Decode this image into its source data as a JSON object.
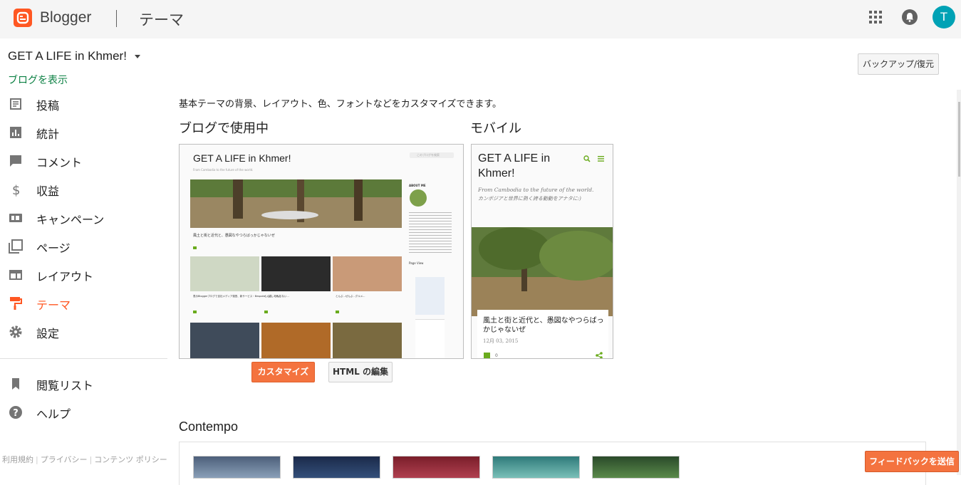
{
  "header": {
    "brand": "Blogger",
    "section_title": "テーマ",
    "avatar_initial": "T"
  },
  "sidebar": {
    "blog_name": "GET A LIFE in Khmer!",
    "view_blog": "ブログを表示",
    "items": [
      {
        "label": "投稿",
        "icon": "posts-icon"
      },
      {
        "label": "統計",
        "icon": "stats-icon"
      },
      {
        "label": "コメント",
        "icon": "comment-icon"
      },
      {
        "label": "収益",
        "icon": "dollar-icon"
      },
      {
        "label": "キャンペーン",
        "icon": "ad-icon"
      },
      {
        "label": "ページ",
        "icon": "pages-icon"
      },
      {
        "label": "レイアウト",
        "icon": "layout-icon"
      },
      {
        "label": "テーマ",
        "icon": "paint-roller-icon",
        "active": true
      },
      {
        "label": "設定",
        "icon": "gear-icon"
      }
    ],
    "secondary_items": [
      {
        "label": "閲覧リスト",
        "icon": "bookmark-icon"
      },
      {
        "label": "ヘルプ",
        "icon": "help-icon"
      }
    ],
    "footer_links": [
      "利用規約",
      "プライバシー",
      "コンテンツ ポリシー"
    ]
  },
  "main": {
    "backup_button": "バックアップ/復元",
    "description": "基本テーマの背景、レイアウト、色、フォントなどをカスタマイズできます。",
    "live_heading": "ブログで使用中",
    "mobile_heading": "モバイル",
    "customize_button": "カスタマイズ",
    "edit_html_button": "HTML の編集",
    "gallery_heading": "Contempo",
    "feedback_button": "フィードバックを送信"
  },
  "desktop_preview": {
    "blog_title": "GET A LIFE in Khmer!",
    "tagline": "From Cambodia to the future of the world.",
    "search_placeholder": "このブログを検索",
    "post_title": "風土と街と近代と、愚図なやつらばっかじゃないぜ",
    "about_heading": "ABOUT ME",
    "page_view_label": "Page View",
    "grid_captions": [
      "表示Bloggerブログで自社メディア運営、新サービス・Bespoke... 試してみた",
      "とんぷ...ぜんぶない...",
      "とんぷ...ぜんぶ...グルメ..."
    ]
  },
  "mobile_preview": {
    "blog_title": "GET A LIFE in Khmer!",
    "tagline": "From Cambodia to the future of the world.",
    "tagline_jp": "カンボジアと世界に熱く誇る動動をアナタに:)",
    "post_title": "風土と街と近代と、愚図なやつらばっかじゃないぜ",
    "post_date": "12月 03, 2015",
    "comment_count": "0"
  },
  "colors": {
    "accent": "#ff5722",
    "link": "#0b8043",
    "avatar": "#00a2b5",
    "button_orange": "#f4733f"
  }
}
